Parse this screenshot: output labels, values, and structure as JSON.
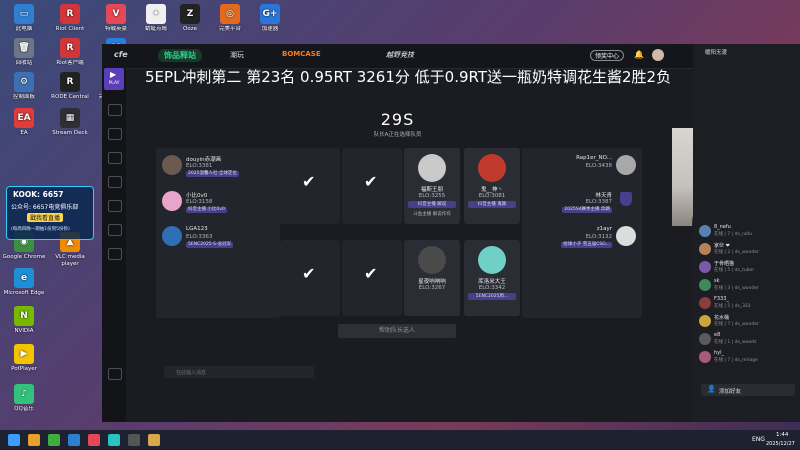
{
  "desktop": {
    "icons": [
      {
        "label": "此电脑",
        "color": "#2f7fd1",
        "glyph": "▭"
      },
      {
        "label": "Riot Client",
        "color": "#d13639",
        "glyph": "R"
      },
      {
        "label": "特戰英豪",
        "color": "#e74856",
        "glyph": "V"
      },
      {
        "label": "蜻蜓点睛",
        "color": "#f0f0f0",
        "glyph": "✦"
      },
      {
        "label": "Ooze",
        "color": "#222222",
        "glyph": "Z"
      },
      {
        "label": "完美平台",
        "color": "#e06b1f",
        "glyph": "◎"
      },
      {
        "label": "加速器",
        "color": "#2a76d9",
        "glyph": "G+"
      },
      {
        "label": "回收站",
        "color": "#6b7787",
        "glyph": "🗑"
      },
      {
        "label": "Riot客户端",
        "color": "#d13639",
        "glyph": "R"
      },
      {
        "label": "腾讯会议",
        "color": "#2a7de1",
        "glyph": "M"
      },
      {
        "label": "控制面板",
        "color": "#3d6fb3",
        "glyph": "⚙"
      },
      {
        "label": "RODE Central",
        "color": "#222222",
        "glyph": "R"
      },
      {
        "label": "完美世界 平台",
        "color": "#d9a84a",
        "glyph": "▲"
      },
      {
        "label": "EA",
        "color": "#e03c3c",
        "glyph": "EA"
      },
      {
        "label": "Stream Deck",
        "color": "#2e2e36",
        "glyph": "▦"
      },
      {
        "label": "无畏契约",
        "color": "#e74856",
        "glyph": "V"
      },
      {
        "label": "Google Chrome",
        "color": "#3b8f3e",
        "glyph": "◉"
      },
      {
        "label": "VLC media player",
        "color": "#f08a00",
        "glyph": "▲"
      },
      {
        "label": "Microsoft Edge",
        "color": "#1d8fd8",
        "glyph": "e"
      },
      {
        "label": "NVIDIA",
        "color": "#76b900",
        "glyph": "N"
      },
      {
        "label": "PotPlayer",
        "color": "#f5c400",
        "glyph": "▶"
      },
      {
        "label": "QQ音乐",
        "color": "#31c27c",
        "glyph": "♪"
      }
    ],
    "streamer_card": {
      "kook_label": "KOOK: 6657",
      "gzh_label": "公众号: 6657电竞俱乐部",
      "follow_label": "戳我看直播",
      "note_label": "(每周四晚一期抽1份到5份钞)"
    }
  },
  "app": {
    "logo_text": "cfe",
    "nav": [
      "饰品释站",
      "潮玩",
      "BOMCASE"
    ],
    "center_logo": "越野竞技",
    "right_badge": "领奖中心",
    "play_label": "PLAY"
  },
  "overlay": {
    "banner": "5EPL冲刺第二 第23名 0.95RT 3261分   低于0.9RT送一瓶奶特调花生酱2胜2负"
  },
  "draft": {
    "timer": "29S",
    "message": "队长A正在选择队员",
    "team_a": [
      {
        "name": "douyin赤潮画",
        "elo": "ELO:3381",
        "tag": "2025温馨人社·全球定位",
        "avatar": "#6b5a4d"
      },
      {
        "name": "小比0v0",
        "elo": "ELO:3158",
        "tag": "抖音主播 小比0v0",
        "avatar": "#e8a5c9"
      },
      {
        "name": "LGA123",
        "elo": "ELO:3363",
        "tag": "5ENC2025·S-总冠军",
        "avatar": "#2f6fb8"
      }
    ],
    "team_b": [
      {
        "name": "Rap1er_NO...",
        "elo": "ELO:3438",
        "tag": "",
        "avatar": "#a8a8a8"
      },
      {
        "name": "林天青",
        "elo": "ELO:3387",
        "tag": "2025S4赛季主播 奔路",
        "avatar": "#3a3a58"
      },
      {
        "name": "z1ayr",
        "elo": "ELO:3132",
        "tag": "绘球小子 雪五届CSG...",
        "avatar": "#dcdcdc"
      }
    ],
    "pool": [
      {
        "name": "福斯王朋",
        "elo": "ELO:3255",
        "tag": "抖音主播 解说",
        "sub": "斗鱼主播 解说作作",
        "avatar": "#c9c9c9"
      },
      {
        "name": "鬼__神丶",
        "elo": "ELO:3081",
        "tag": "抖音主播 鬼颖",
        "sub": "",
        "avatar": "#c0392b"
      },
      {
        "name": "星夜响响响",
        "elo": "ELO:3267",
        "tag": "",
        "sub": "",
        "avatar": "#4a4a4a"
      },
      {
        "name": "库洛米大王",
        "elo": "ELO:3342",
        "tag": "5ENC2025周...",
        "sub": "",
        "avatar": "#6fd0c6"
      }
    ],
    "confirm_button": "帮助队长选人",
    "chat_placeholder": "在此输入消息"
  },
  "side_panel": {
    "title": "暖阳无渡",
    "chat_items": [
      {
        "name": "8_nefu",
        "status": "在线 | 7 | ds_nafu",
        "avatar": "#5a7fb5"
      },
      {
        "name": "家伙 ❤",
        "status": "在线 | 2 | ds_wonder",
        "avatar": "#b5825a"
      },
      {
        "name": "于骨晒猫",
        "status": "在线 | 5 | ds_tuber",
        "avatar": "#7a5aa8"
      },
      {
        "name": "sk",
        "status": "在线 | 3 | ds_wonder",
        "avatar": "#3d8a5a"
      },
      {
        "name": "F333_",
        "status": "在线 | 5 | ds_333",
        "avatar": "#8a3d3d"
      },
      {
        "name": "花水桶",
        "status": "在线 | 7 | ds_wonder",
        "avatar": "#c9a53d"
      },
      {
        "name": "e8",
        "status": "在线 | 1 | ds_woods",
        "avatar": "#5a5a5a"
      },
      {
        "name": "hyl_",
        "status": "在线 | 7 | ds_mirage",
        "avatar": "#a85a7a"
      }
    ],
    "add_friend": "添加好友"
  },
  "taskbar": {
    "language": "ENG",
    "time": "1:44",
    "date": "2025/12/27"
  }
}
